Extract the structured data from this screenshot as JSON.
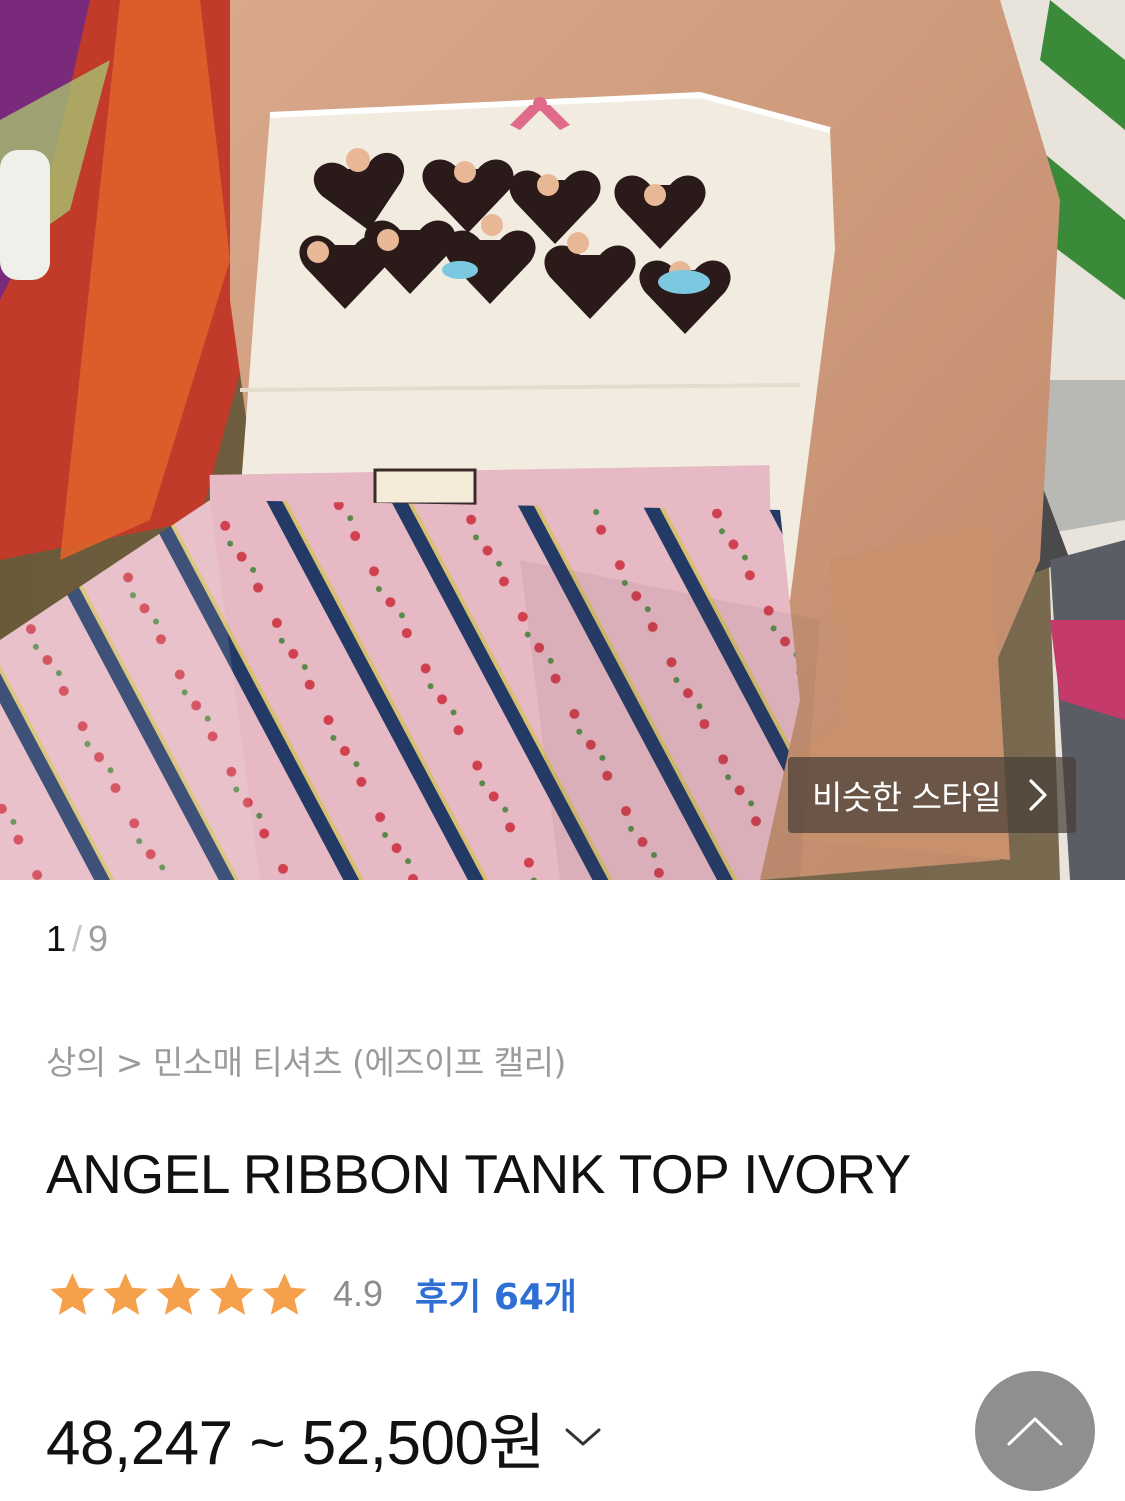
{
  "product_image": {
    "alt": "product photo",
    "similar_style_label": "비슷한 스타일"
  },
  "pager": {
    "current": "1",
    "separator": "/",
    "total": "9"
  },
  "breadcrumb": {
    "text": "상의 > 민소매 티셔츠 (에즈이프 캘리)"
  },
  "product": {
    "title": "ANGEL RIBBON TANK TOP IVORY",
    "rating": "4.9",
    "rating_stars": 5,
    "review_label": "후기 64개",
    "price": "48,247 ~ 52,500원"
  },
  "colors": {
    "star": "#f5a04a",
    "review_link": "#2f6fd4",
    "scroll_button": "#8f8f8f"
  },
  "icons": {
    "similar_chevron": "chevron-right-icon",
    "price_toggle": "chevron-down-icon",
    "scroll_top": "chevron-up-icon",
    "star": "star-icon"
  }
}
